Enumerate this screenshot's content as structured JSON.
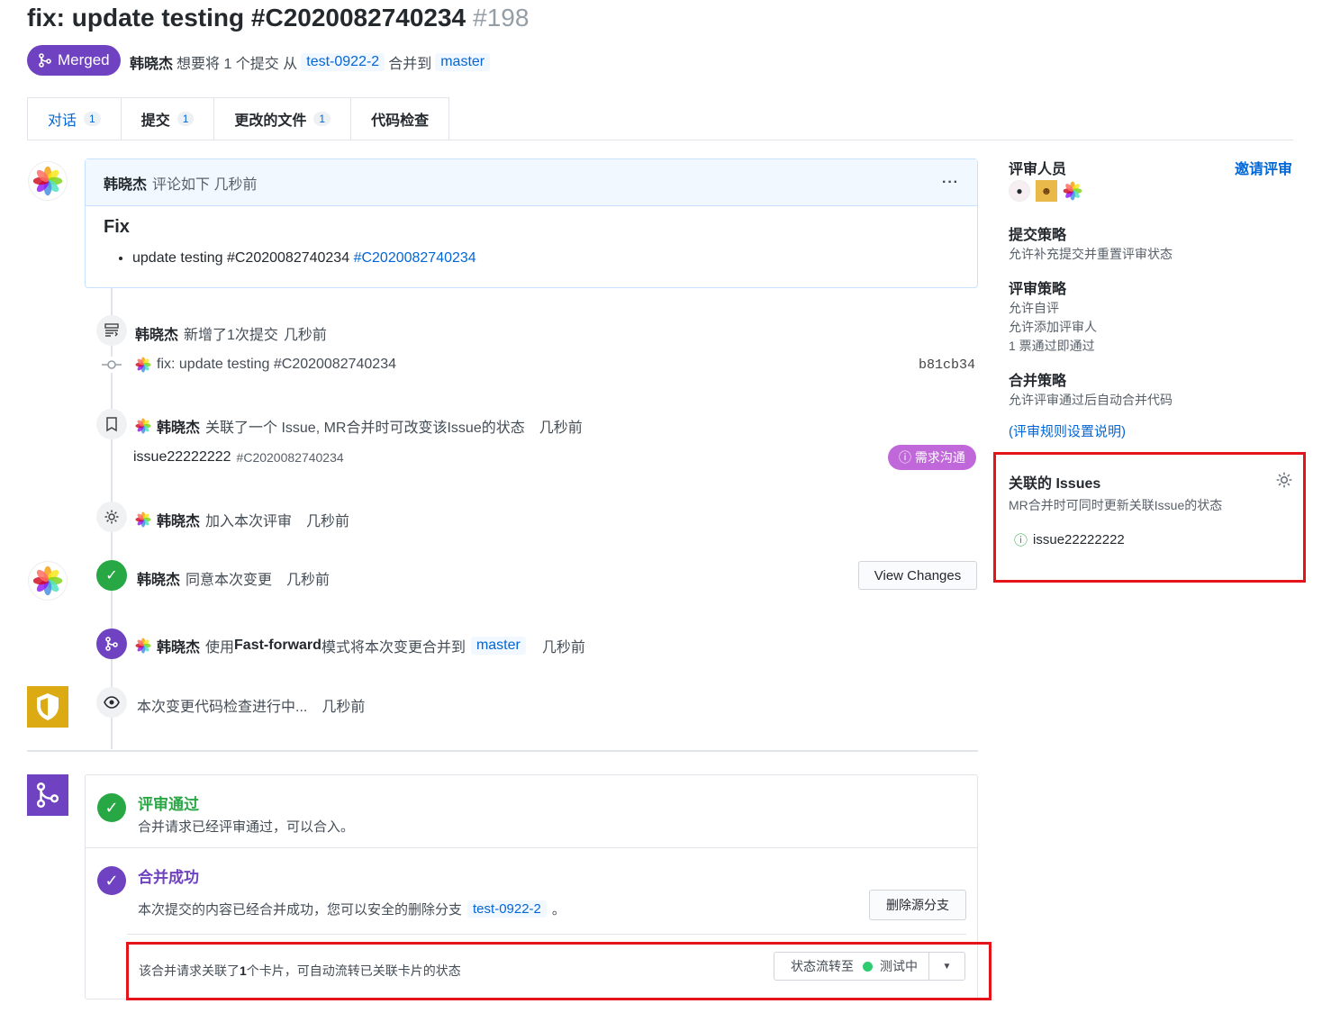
{
  "header": {
    "title": "fix: update testing #C2020082740234",
    "number": "#198",
    "status": "Merged",
    "author": "韩晓杰",
    "wants_merge": "想要将 1 个提交 从",
    "source_branch": "test-0922-2",
    "merge_into": "合并到",
    "target_branch": "master"
  },
  "tabs": [
    {
      "label": "对话",
      "count": "1"
    },
    {
      "label": "提交",
      "count": "1"
    },
    {
      "label": "更改的文件",
      "count": "1"
    },
    {
      "label": "代码检查",
      "count": ""
    }
  ],
  "comment": {
    "author": "韩晓杰",
    "meta": "评论如下 几秒前",
    "more": "···",
    "heading": "Fix",
    "bullet_text": "update testing #C2020082740234",
    "bullet_link": "#C2020082740234"
  },
  "events": {
    "commit_added": {
      "author": "韩晓杰",
      "text": "新增了1次提交",
      "time": "几秒前"
    },
    "commit": {
      "message": "fix: update testing #C2020082740234",
      "sha": "b81cb34"
    },
    "issue_linked": {
      "author": "韩晓杰",
      "text": "关联了一个 Issue, MR合并时可改变该Issue的状态",
      "time": "几秒前",
      "issue_name": "issue22222222",
      "issue_ref": "#C2020082740234",
      "issue_status": "需求沟通"
    },
    "joined_review": {
      "author": "韩晓杰",
      "text": "加入本次评审",
      "time": "几秒前"
    },
    "approved": {
      "author": "韩晓杰",
      "text": "同意本次变更",
      "time": "几秒前",
      "button": "View Changes"
    },
    "merged": {
      "author": "韩晓杰",
      "text_pre": "使用",
      "mode": "Fast-forward",
      "text_post": "模式将本次变更合并到",
      "branch": "master",
      "time": "几秒前"
    },
    "code_check": {
      "text": "本次变更代码检查进行中...",
      "time": "几秒前"
    }
  },
  "merge_box": {
    "review_title": "评审通过",
    "review_desc": "合并请求已经评审通过，可以合入。",
    "merge_title": "合并成功",
    "merge_desc_pre": "本次提交的内容已经合并成功，您可以安全的删除分支",
    "merge_branch": "test-0922-2",
    "merge_desc_post": "。",
    "delete_button": "删除源分支",
    "card_text_pre": "该合并请求关联了",
    "card_count": "1",
    "card_text_post": "个卡片，可自动流转已关联卡片的状态",
    "flow_label": "状态流转至",
    "flow_status": "测试中",
    "flow_status_color": "#2ecc71"
  },
  "sidebar": {
    "reviewers_title": "评审人员",
    "invite": "邀请评审",
    "submit_policy_title": "提交策略",
    "submit_policy": "允许补充提交并重置评审状态",
    "review_policy_title": "评审策略",
    "review_policy": [
      "允许自评",
      "允许添加评审人",
      "1 票通过即通过"
    ],
    "merge_policy_title": "合并策略",
    "merge_policy": "允许评审通过后自动合并代码",
    "rules_link": "(评审规则设置说明)",
    "issues_title": "关联的 Issues",
    "issues_desc": "MR合并时可同时更新关联Issue的状态",
    "issue_item": "issue22222222"
  },
  "colors": {
    "merged_purple": "#6f42c1",
    "link_blue": "#0366d6",
    "success_green": "#28a745",
    "highlight_red": "#e5131a",
    "shield_yellow": "#dcaa12"
  }
}
